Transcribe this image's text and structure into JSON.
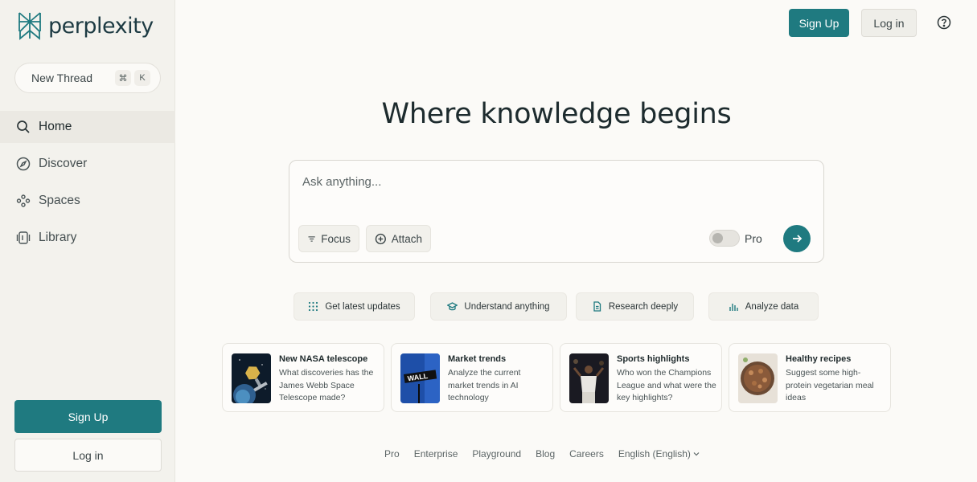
{
  "sidebar": {
    "logo_text": "perplexity",
    "new_thread": {
      "label": "New Thread",
      "keys": [
        "⌘",
        "K"
      ]
    },
    "nav": [
      {
        "label": "Home",
        "icon": "search-icon",
        "active": true
      },
      {
        "label": "Discover",
        "icon": "compass-icon",
        "active": false
      },
      {
        "label": "Spaces",
        "icon": "spaces-icon",
        "active": false
      },
      {
        "label": "Library",
        "icon": "library-icon",
        "active": false
      }
    ],
    "signup_label": "Sign Up",
    "login_label": "Log in"
  },
  "header": {
    "signup_label": "Sign Up",
    "login_label": "Log in",
    "help_icon": "help-icon"
  },
  "main": {
    "headline": "Where knowledge begins",
    "search": {
      "placeholder": "Ask anything...",
      "focus_label": "Focus",
      "attach_label": "Attach",
      "pro_label": "Pro",
      "pro_enabled": false
    },
    "chips": [
      {
        "label": "Get latest updates",
        "icon": "grid-icon"
      },
      {
        "label": "Understand anything",
        "icon": "graduation-cap-icon"
      },
      {
        "label": "Research deeply",
        "icon": "document-icon"
      },
      {
        "label": "Analyze data",
        "icon": "bar-chart-icon"
      }
    ],
    "cards": [
      {
        "title": "New NASA telescope",
        "desc": "What discoveries has the James Webb Space Telescope made?"
      },
      {
        "title": "Market trends",
        "desc": "Analyze the current market trends in AI technology"
      },
      {
        "title": "Sports highlights",
        "desc": "Who won the Champions League and what were the key highlights?"
      },
      {
        "title": "Healthy recipes",
        "desc": "Suggest some high-protein vegetarian meal ideas"
      }
    ]
  },
  "footer": {
    "links": [
      "Pro",
      "Enterprise",
      "Playground",
      "Blog",
      "Careers",
      "English (English)"
    ]
  },
  "colors": {
    "accent": "#1f7a80",
    "background": "#fbfaf7",
    "sidebar": "#f3f2ed"
  }
}
